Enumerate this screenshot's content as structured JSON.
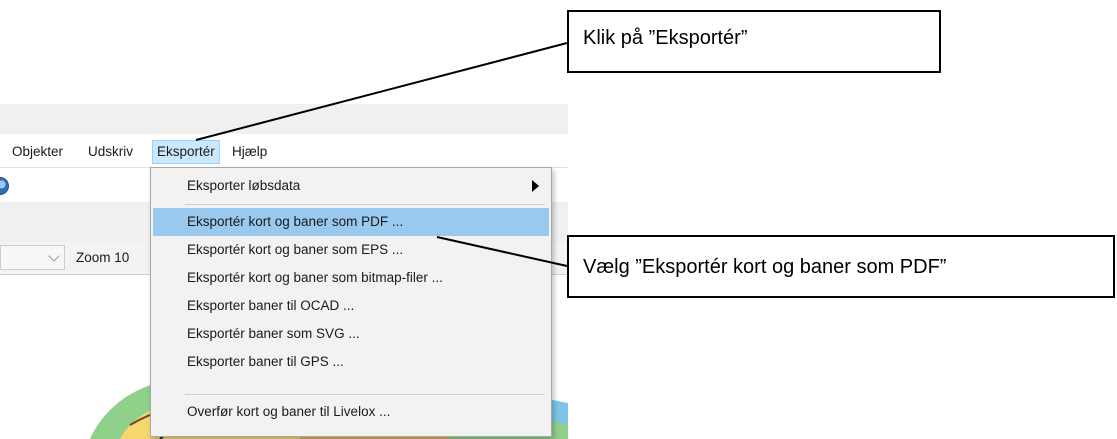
{
  "menubar": {
    "items": [
      "Objekter",
      "Udskriv",
      "Eksportér",
      "Hjælp"
    ],
    "active_index": 2
  },
  "toolbar": {
    "zoom_label": "Zoom 10"
  },
  "export_menu": {
    "items": [
      {
        "label": "Eksporter løbsdata",
        "has_submenu": true
      },
      {
        "label": "Eksportér kort og baner som PDF ...",
        "highlighted": true
      },
      {
        "label": "Eksportér kort og baner som EPS ..."
      },
      {
        "label": "Eksportér kort og baner som bitmap-filer ..."
      },
      {
        "label": "Eksporter baner til OCAD ..."
      },
      {
        "label": "Eksportér baner som SVG ..."
      },
      {
        "label": "Eksporter baner til GPS ..."
      },
      {
        "label": "Overfør kort og baner til Livelox ..."
      }
    ]
  },
  "callouts": {
    "first": "Klik på ”Eksportér”",
    "second": "Vælg ”Eksportér kort og baner som PDF”"
  },
  "colors": {
    "menu_highlight": "#99c9ef",
    "menubar_active": "#cce8ff",
    "map_green": "#8fd18a",
    "map_lake": "#7ec4e6",
    "map_course": "#c23ac2"
  }
}
